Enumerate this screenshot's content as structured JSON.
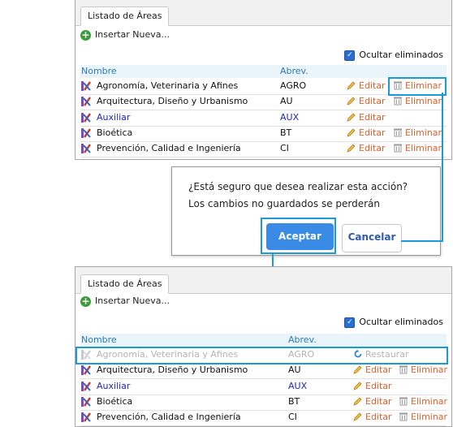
{
  "tab_label": "Listado de Áreas",
  "insert_label": "Insertar Nueva...",
  "show_deleted_label": "Ocultar eliminados",
  "col_name": "Nombre",
  "col_abbr": "Abrev.",
  "edit_label": "Editar",
  "delete_label": "Eliminar",
  "restore_label": "Restaurar",
  "top_rows": [
    {
      "name": "Agronomía, Veterinaria y Afines",
      "abbr": "AGRO"
    },
    {
      "name": "Arquitectura, Diseño y Urbanismo",
      "abbr": "AU"
    },
    {
      "name": "Auxiliar",
      "abbr": "AUX"
    },
    {
      "name": "Bioética",
      "abbr": "BT"
    },
    {
      "name": "Prevención, Calidad e Ingeniería",
      "abbr": "CI"
    }
  ],
  "bottom_rows": [
    {
      "name": "Agronomía, Veterinaria y Afines",
      "abbr": "AGRO"
    },
    {
      "name": "Arquitectura, Diseño y Urbanismo",
      "abbr": "AU"
    },
    {
      "name": "Auxiliar",
      "abbr": "AUX"
    },
    {
      "name": "Bioética",
      "abbr": "BT"
    },
    {
      "name": "Prevención, Calidad e Ingeniería",
      "abbr": "CI"
    }
  ],
  "dialog": {
    "message_line1": "¿Está seguro que desea realizar esta acción?",
    "message_line2": "Los cambios no guardados se perderán",
    "ok_label": "Aceptar",
    "cancel_label": "Cancelar"
  },
  "colors": {
    "highlight": "#1a9ad6",
    "action": "#e0602a",
    "link_blue": "#2323c8",
    "header_blue": "#2b7ab8"
  }
}
